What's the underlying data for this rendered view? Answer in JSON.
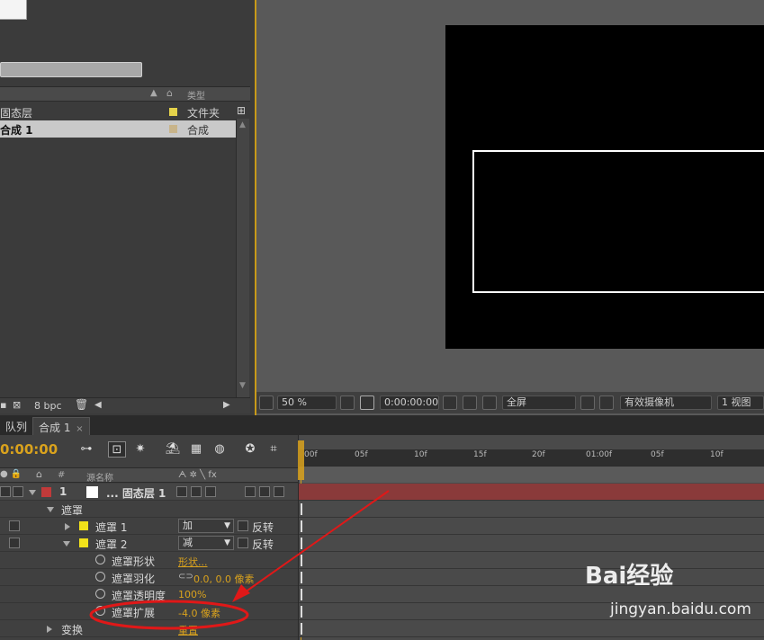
{
  "project": {
    "columns": {
      "type": "类型"
    },
    "items": [
      {
        "name": "固态层",
        "type": "文件夹",
        "color": "#e4d24a"
      },
      {
        "name": "合成 1",
        "type": "合成",
        "color": "#c8b48a"
      }
    ],
    "bottom": {
      "bpc": "8 bpc"
    }
  },
  "viewer": {
    "zoom": "50 %",
    "timecode": "0:00:00:00",
    "resolution": "全屏",
    "camera": "有效摄像机",
    "views": "1 视图"
  },
  "timeline": {
    "tabs": [
      "队列",
      "合成 1"
    ],
    "close_glyph": "×",
    "current_time": "0:00:00",
    "col_source": "源名称",
    "col_hash": "#",
    "col_switches": "ᗅ ✲ ╲ fx",
    "ruler": [
      "00f",
      "05f",
      "10f",
      "15f",
      "20f",
      "01:00f",
      "05f",
      "10f"
    ],
    "layer": {
      "index": "1",
      "name": "... 固态层 1",
      "color": "#c13a3a"
    },
    "masks_group": "遮罩",
    "masks": [
      {
        "name": "遮罩 1",
        "mode": "加",
        "invert": "反转"
      },
      {
        "name": "遮罩 2",
        "mode": "减",
        "invert": "反转"
      }
    ],
    "properties": [
      {
        "name": "遮罩形状",
        "value": "形状..."
      },
      {
        "name": "遮罩羽化",
        "value": "0.0, 0.0 像素"
      },
      {
        "name": "遮罩透明度",
        "value": "100%"
      },
      {
        "name": "遮罩扩展",
        "value": "-4.0 像素"
      }
    ],
    "transform": {
      "name": "变换",
      "value": "重置"
    }
  },
  "watermark": {
    "brand": "Bai经验",
    "url": "jingyan.baidu.com"
  },
  "colors": {
    "accent": "#d9a21d",
    "annotation": "#e01818",
    "layer_bar": "#8a3a3a"
  }
}
